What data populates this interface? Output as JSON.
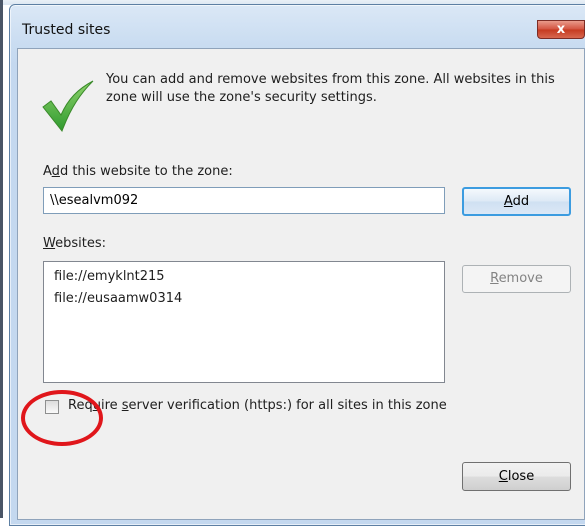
{
  "window": {
    "title": "Trusted sites",
    "close_glyph": "x"
  },
  "info_text": "You can add and remove websites from this zone. All websites in this zone will use the zone's security settings.",
  "add_section": {
    "label_pre": "A",
    "label_key": "d",
    "label_post": "d this website to the zone:",
    "input_value": "\\\\esealvm092",
    "add_key": "A",
    "add_rest": "dd"
  },
  "websites_section": {
    "label_key": "W",
    "label_rest": "ebsites:",
    "items": [
      "file://emyklnt215",
      "file://eusaamw0314"
    ],
    "remove_key": "R",
    "remove_rest": "emove"
  },
  "https_option": {
    "checked": false,
    "label_pre": "Req",
    "label_key": "u",
    "label_mid": "ire ",
    "label_key2": "s",
    "label_post": "erver verification (https:) for all sites in this zone"
  },
  "close_button": {
    "key": "C",
    "rest": "lose"
  },
  "colors": {
    "annotation_circle": "#e0161b",
    "check_icon": "#3aa63a",
    "close_button": "#c5391f"
  }
}
